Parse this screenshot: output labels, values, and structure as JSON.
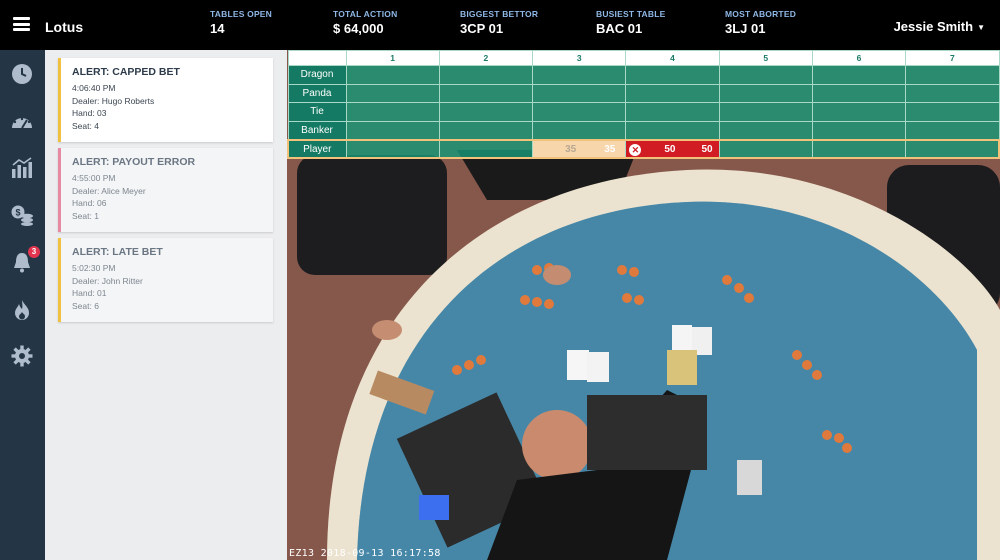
{
  "app": {
    "name": "Lotus"
  },
  "stats": [
    {
      "label": "TABLES OPEN",
      "value": "14"
    },
    {
      "label": "TOTAL ACTION",
      "value": "$ 64,000"
    },
    {
      "label": "BIGGEST BETTOR",
      "value": "3CP 01"
    },
    {
      "label": "BUSIEST TABLE",
      "value": "BAC 01"
    },
    {
      "label": "MOST ABORTED",
      "value": "3LJ 01"
    }
  ],
  "user": {
    "name": "Jessie Smith"
  },
  "sidebar": {
    "icons": [
      "clock-icon",
      "gauge-icon",
      "chart-icon",
      "chips-icon",
      "bell-icon",
      "flame-icon",
      "gear-icon"
    ],
    "notification_count": "3"
  },
  "alerts": [
    {
      "title": "ALERT: CAPPED BET",
      "time": "4:06:40 PM",
      "dealer": "Dealer: Hugo Roberts",
      "hand": "Hand: 03",
      "seat": "Seat: 4",
      "color": "#f0c040"
    },
    {
      "title": "ALERT: PAYOUT ERROR",
      "time": "4:55:00 PM",
      "dealer": "Dealer: Alice Meyer",
      "hand": "Hand: 06",
      "seat": "Seat: 1",
      "color": "#e889a4"
    },
    {
      "title": "ALERT: LATE BET",
      "time": "5:02:30 PM",
      "dealer": "Dealer: John Ritter",
      "hand": "Hand: 01",
      "seat": "Seat: 6",
      "color": "#f0c040"
    }
  ],
  "grid": {
    "columns": [
      "1",
      "2",
      "3",
      "4",
      "5",
      "6",
      "7"
    ],
    "rows": [
      "Dragon",
      "Panda",
      "Tie",
      "Banker",
      "Player"
    ],
    "player_row": {
      "col3_expected": "35",
      "col3_actual": "35",
      "col4_expected": "50",
      "col4_actual": "50"
    }
  },
  "video": {
    "timestamp": "EZ13 2018-09-13 16:17:58"
  },
  "colors": {
    "topbar": "#000000",
    "rail": "#243546",
    "grid_teal": "#169676",
    "error_red": "#d11c24",
    "peach": "#f7d6ac"
  }
}
